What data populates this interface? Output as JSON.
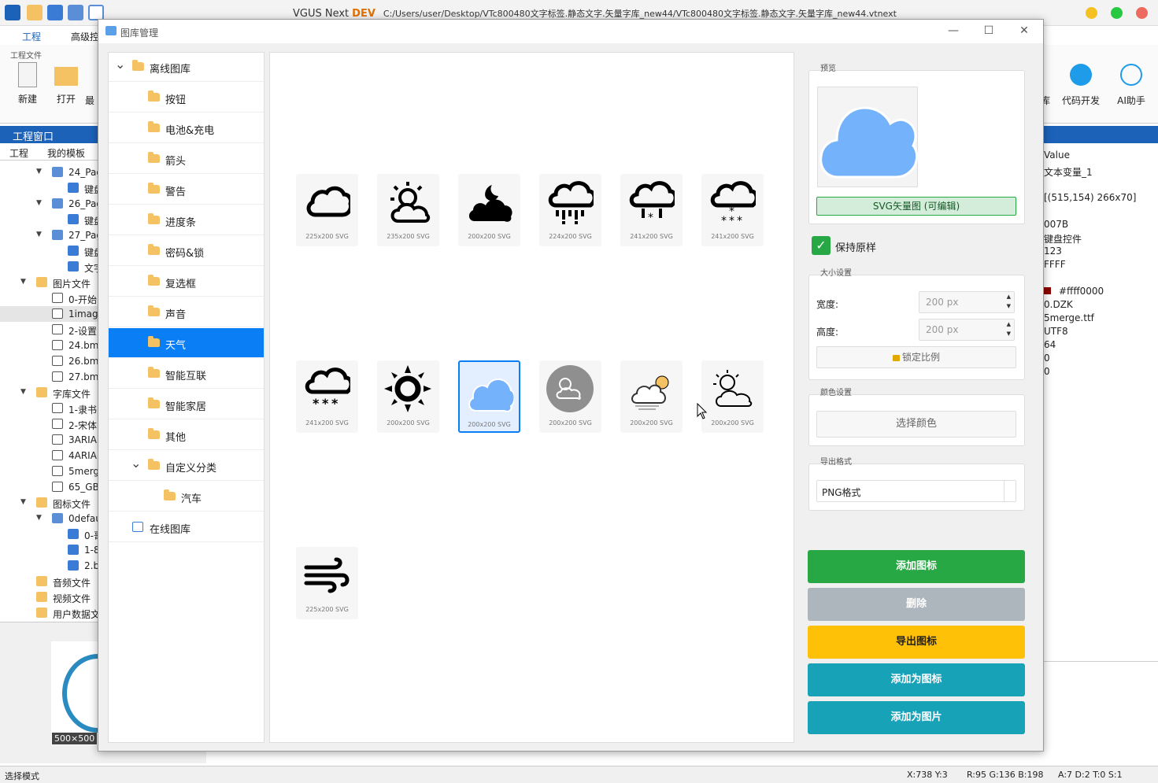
{
  "app": {
    "name": "VGUS Next",
    "badge": "DEV",
    "path": "C:/Users/user/Desktop/VTc800480文字标签.静态文字.矢量字库_new44/VTc800480文字标签.静态文字.矢量字库_new44.vtnext"
  },
  "ribbon": {
    "tabs": [
      "工程",
      "高级控"
    ],
    "group_label": "工程文件",
    "buttons": [
      "新建",
      "打开",
      "最"
    ],
    "right_buttons": [
      "库",
      "代码开发",
      "AI助手"
    ]
  },
  "project_panel": {
    "title": "工程窗口",
    "tabs": [
      "工程",
      "我的模板"
    ],
    "tree": [
      {
        "label": "24_Pag",
        "level": 2,
        "arrow": "v"
      },
      {
        "label": "键盘",
        "level": 3,
        "arrow": ""
      },
      {
        "label": "26_Pag",
        "level": 2,
        "arrow": "v"
      },
      {
        "label": "键盘",
        "level": 3,
        "arrow": ""
      },
      {
        "label": "27_Pag",
        "level": 2,
        "arrow": "v"
      },
      {
        "label": "键盘",
        "level": 3,
        "arrow": ""
      },
      {
        "label": "文字",
        "level": 3,
        "arrow": ""
      },
      {
        "label": "图片文件",
        "level": 1,
        "arrow": "v"
      },
      {
        "label": "0-开始",
        "level": 2,
        "arrow": ""
      },
      {
        "label": "1image",
        "level": 2,
        "arrow": ""
      },
      {
        "label": "2-设置",
        "level": 2,
        "arrow": ""
      },
      {
        "label": "24.bmp",
        "level": 2,
        "arrow": ""
      },
      {
        "label": "26.bmp",
        "level": 2,
        "arrow": ""
      },
      {
        "label": "27.bmp",
        "level": 2,
        "arrow": ""
      },
      {
        "label": "字库文件",
        "level": 1,
        "arrow": "v"
      },
      {
        "label": "1-隶书",
        "level": 2,
        "arrow": ""
      },
      {
        "label": "2-宋体",
        "level": 2,
        "arrow": ""
      },
      {
        "label": "3ARIAL",
        "level": 2,
        "arrow": ""
      },
      {
        "label": "4ARIAL",
        "level": 2,
        "arrow": ""
      },
      {
        "label": "5merg",
        "level": 2,
        "arrow": ""
      },
      {
        "label": "65_GB",
        "level": 2,
        "arrow": ""
      },
      {
        "label": "图标文件",
        "level": 1,
        "arrow": "v"
      },
      {
        "label": "0defau",
        "level": 2,
        "arrow": "v"
      },
      {
        "label": "0-哥",
        "level": 3,
        "arrow": ""
      },
      {
        "label": "1-8",
        "level": 3,
        "arrow": ""
      },
      {
        "label": "2.b",
        "level": 3,
        "arrow": ""
      },
      {
        "label": "音频文件",
        "level": 1,
        "arrow": ""
      },
      {
        "label": "视频文件",
        "level": 1,
        "arrow": ""
      },
      {
        "label": "用户数据文",
        "level": 1,
        "arrow": ""
      }
    ],
    "preview_size": "500×500"
  },
  "props": {
    "header": "Value",
    "values": [
      "文本变量_1",
      "",
      "[(515,154) 266x70]",
      "",
      "007B",
      "键盘控件",
      "123",
      "FFFF",
      "",
      "#ffff0000",
      "0.DZK",
      "5merge.ttf",
      "UTF8",
      "64",
      "0",
      "0"
    ]
  },
  "status": {
    "mode": "选择模式",
    "coords": "X:738  Y:3",
    "rgb": "R:95 G:136 B:198",
    "extra": "A:7  D:2  T:0  S:1"
  },
  "dialog": {
    "title": "图库管理",
    "categories": [
      {
        "label": "离线图库",
        "level": 0,
        "expanded": true,
        "selected": false
      },
      {
        "label": "按钮",
        "level": 1,
        "selected": false
      },
      {
        "label": "电池&充电",
        "level": 1,
        "selected": false
      },
      {
        "label": "箭头",
        "level": 1,
        "selected": false
      },
      {
        "label": "警告",
        "level": 1,
        "selected": false
      },
      {
        "label": "进度条",
        "level": 1,
        "selected": false
      },
      {
        "label": "密码&锁",
        "level": 1,
        "selected": false
      },
      {
        "label": "复选框",
        "level": 1,
        "selected": false
      },
      {
        "label": "声音",
        "level": 1,
        "selected": false
      },
      {
        "label": "天气",
        "level": 1,
        "selected": true
      },
      {
        "label": "智能互联",
        "level": 1,
        "selected": false
      },
      {
        "label": "智能家居",
        "level": 1,
        "selected": false
      },
      {
        "label": "其他",
        "level": 1,
        "selected": false
      },
      {
        "label": "自定义分类",
        "level": 1,
        "expanded": true,
        "selected": false
      },
      {
        "label": "汽车",
        "level": 2,
        "selected": false
      },
      {
        "label": "在线图库",
        "level": 0,
        "selected": false
      }
    ],
    "icons": [
      {
        "icon": "cloud-icon",
        "caption": "225x200 SVG"
      },
      {
        "icon": "sun-cloud-icon",
        "caption": "235x200 SVG"
      },
      {
        "icon": "moon-cloud-icon",
        "caption": "200x200 SVG"
      },
      {
        "icon": "rain-cloud-icon",
        "caption": "224x200 SVG"
      },
      {
        "icon": "sleet-cloud-icon",
        "caption": "241x200 SVG"
      },
      {
        "icon": "snow-cloud-icon",
        "caption": "241x200 SVG"
      },
      {
        "icon": "heavy-snow-icon",
        "caption": "241x200 SVG"
      },
      {
        "icon": "sun-icon",
        "caption": "200x200 SVG"
      },
      {
        "icon": "blue-cloud-icon",
        "caption": "200x200 SVG",
        "selected": true
      },
      {
        "icon": "gray-weather-badge-icon",
        "caption": "200x200 SVG"
      },
      {
        "icon": "partly-sunny-icon",
        "caption": "200x200 SVG"
      },
      {
        "icon": "sun-behind-cloud-outline-icon",
        "caption": "200x200 SVG"
      },
      {
        "icon": "wind-icon",
        "caption": "225x200 SVG"
      }
    ],
    "preview": {
      "label": "预览",
      "tag": "SVG矢量图 (可编辑)"
    },
    "keep_original": {
      "label": "保持原样",
      "checked": true
    },
    "size": {
      "label": "大小设置",
      "width_label": "宽度:",
      "width_value": "200 px",
      "height_label": "高度:",
      "height_value": "200 px",
      "lock_label": "锁定比例"
    },
    "color": {
      "label": "颜色设置",
      "button": "选择颜色"
    },
    "export": {
      "label": "导出格式",
      "value": "PNG格式"
    },
    "actions": {
      "add_icon": "添加图标",
      "delete": "删除",
      "export_icon": "导出图标",
      "add_as_icon": "添加为图标",
      "add_as_image": "添加为图片"
    },
    "colors": {
      "selected": "#0a7ef5",
      "green": "#28a745",
      "gray": "#adb5bd",
      "yellow": "#ffc107",
      "teal": "#17a2b8",
      "cloud_blue": "#74b3fb"
    }
  }
}
